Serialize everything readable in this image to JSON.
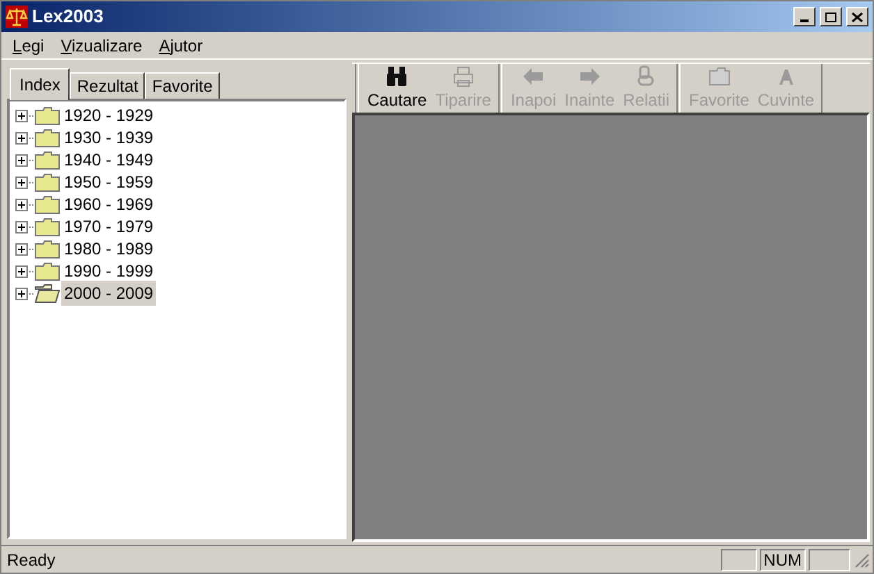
{
  "window": {
    "title": "Lex2003"
  },
  "menu": [
    "Legi",
    "Vizualizare",
    "Ajutor"
  ],
  "tabs": [
    {
      "label": "Index",
      "selected": true
    },
    {
      "label": "Rezultat",
      "selected": false
    },
    {
      "label": "Favorite",
      "selected": false
    }
  ],
  "tree": [
    {
      "label": "1920 - 1929",
      "expanded": false,
      "selected": false
    },
    {
      "label": "1930 - 1939",
      "expanded": false,
      "selected": false
    },
    {
      "label": "1940 - 1949",
      "expanded": false,
      "selected": false
    },
    {
      "label": "1950 - 1959",
      "expanded": false,
      "selected": false
    },
    {
      "label": "1960 - 1969",
      "expanded": false,
      "selected": false
    },
    {
      "label": "1970 - 1979",
      "expanded": false,
      "selected": false
    },
    {
      "label": "1980 - 1989",
      "expanded": false,
      "selected": false
    },
    {
      "label": "1990 - 1999",
      "expanded": false,
      "selected": false
    },
    {
      "label": "2000 - 2009",
      "expanded": false,
      "selected": true
    }
  ],
  "toolbar": [
    [
      {
        "kind": "binoculars",
        "label": "Cautare",
        "disabled": false
      },
      {
        "kind": "printer",
        "label": "Tiparire",
        "disabled": true
      }
    ],
    [
      {
        "kind": "back",
        "label": "Inapoi",
        "disabled": true
      },
      {
        "kind": "forward",
        "label": "Inainte",
        "disabled": true
      },
      {
        "kind": "link",
        "label": "Relatii",
        "disabled": true
      }
    ],
    [
      {
        "kind": "folder",
        "label": "Favorite",
        "disabled": true
      },
      {
        "kind": "font",
        "label": "Cuvinte",
        "disabled": true
      }
    ]
  ],
  "status_bar": {
    "text": "Ready",
    "panels": [
      "NUM"
    ]
  }
}
